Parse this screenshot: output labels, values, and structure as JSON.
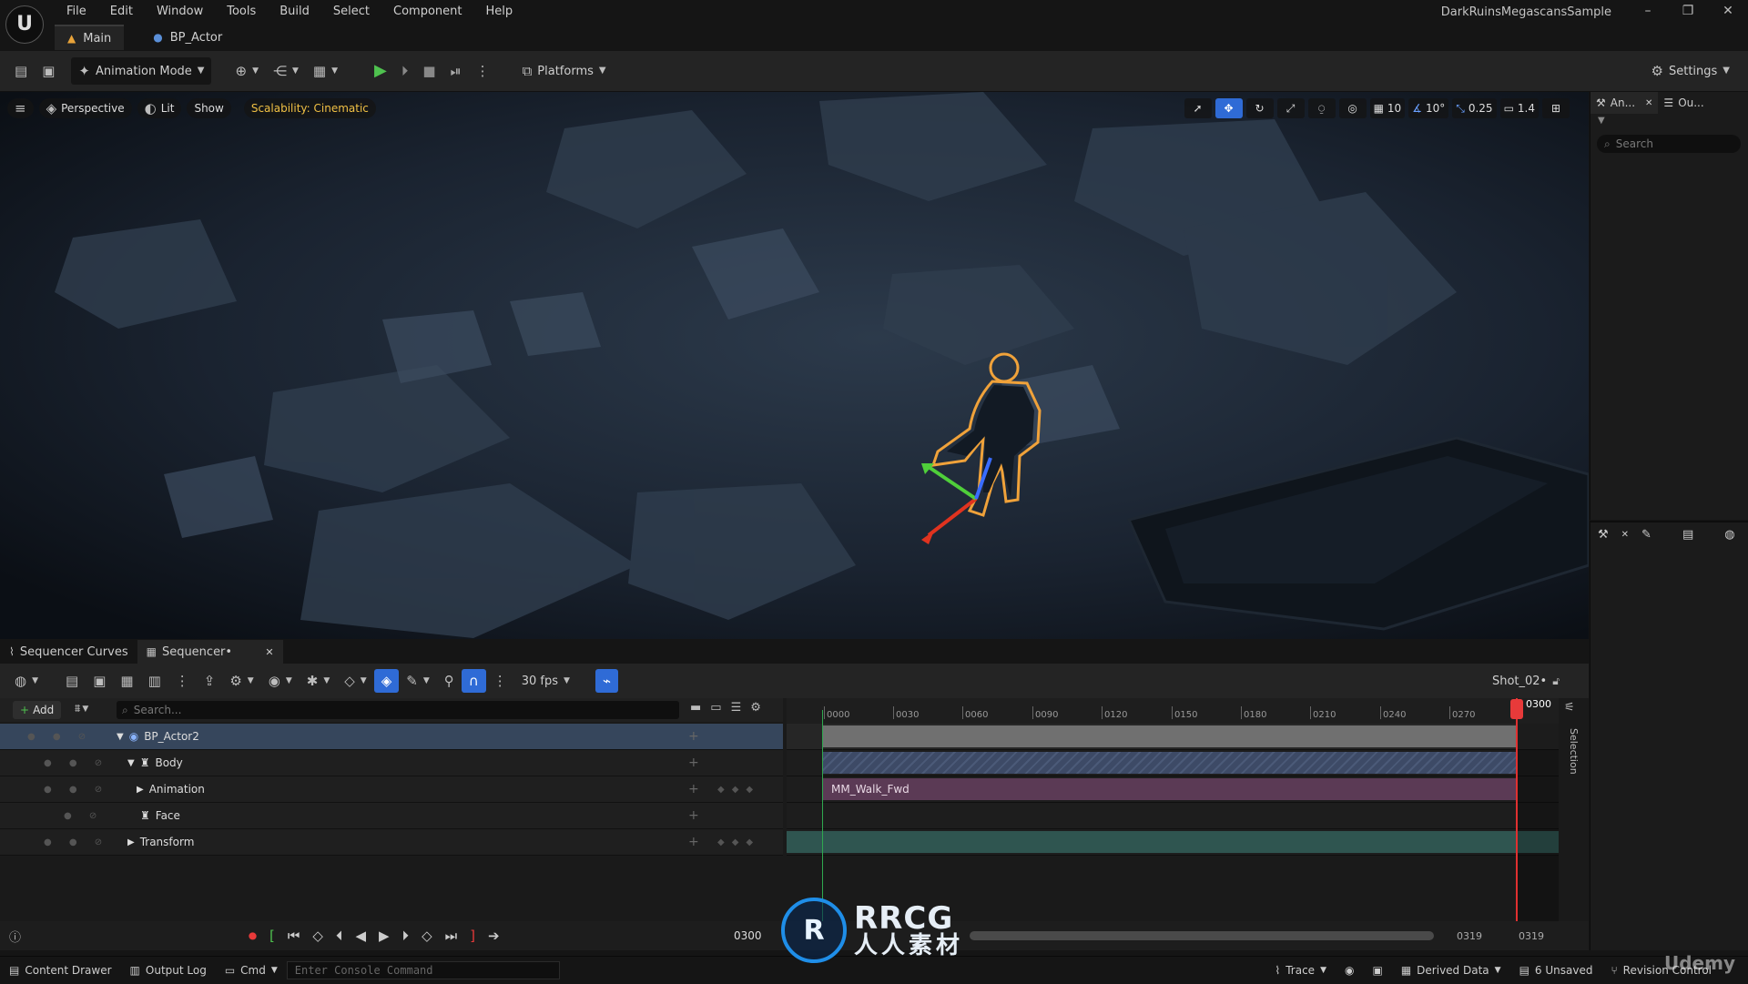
{
  "menu": [
    "File",
    "Edit",
    "Window",
    "Tools",
    "Build",
    "Select",
    "Component",
    "Help"
  ],
  "doc_tabs": {
    "main": "Main",
    "bp_actor": "BP_Actor"
  },
  "project_name": "DarkRuinsMegascansSample",
  "window_controls": {
    "minimize": "–",
    "restore": "❐",
    "close": "✕"
  },
  "toolbar": {
    "mode": "Animation Mode",
    "platforms": "Platforms",
    "settings": "Settings"
  },
  "viewport": {
    "perspective": "Perspective",
    "lit": "Lit",
    "show": "Show",
    "scalability": "Scalability: Cinematic",
    "grid_snap": "10",
    "rot_snap": "10°",
    "scale_snap": "0.25",
    "cam_speed": "1.4"
  },
  "right_panel": {
    "tab1": "An...",
    "tab2": "Ou...",
    "search_placeholder": "Search"
  },
  "sequencer": {
    "tab_curves": "Sequencer Curves",
    "tab_sequencer": "Sequencer•",
    "fps": "30 fps",
    "shot": "Shot_02•",
    "add": "Add",
    "search_placeholder": "Search...",
    "selection_label": "Selection",
    "tracks": {
      "actor": "BP_Actor2",
      "body": "Body",
      "animation": "Animation",
      "face": "Face",
      "transform": "Transform"
    },
    "clip": "MM_Walk_Fwd",
    "ruler": [
      "0000",
      "0030",
      "0060",
      "0090",
      "0120",
      "0150",
      "0180",
      "0210",
      "0240",
      "0270"
    ],
    "playhead": "0300",
    "current_frame": "0300",
    "range_start": "0319",
    "range_end": "0319",
    "colors": {
      "accent": "#2f6bd6",
      "playhead": "#e83a3a",
      "clip": "#5b3a55",
      "body_bar": "#3d4a66",
      "transform_bar": "#2f5550"
    }
  },
  "status": {
    "content_drawer": "Content Drawer",
    "output_log": "Output Log",
    "cmd": "Cmd",
    "console_placeholder": "Enter Console Command",
    "trace": "Trace",
    "derived_data": "Derived Data",
    "unsaved": "6 Unsaved",
    "revision": "Revision Control"
  },
  "watermark": {
    "logo": "R",
    "line1": "RRCG",
    "line2": "人人素材",
    "udemy": "Udemy"
  }
}
